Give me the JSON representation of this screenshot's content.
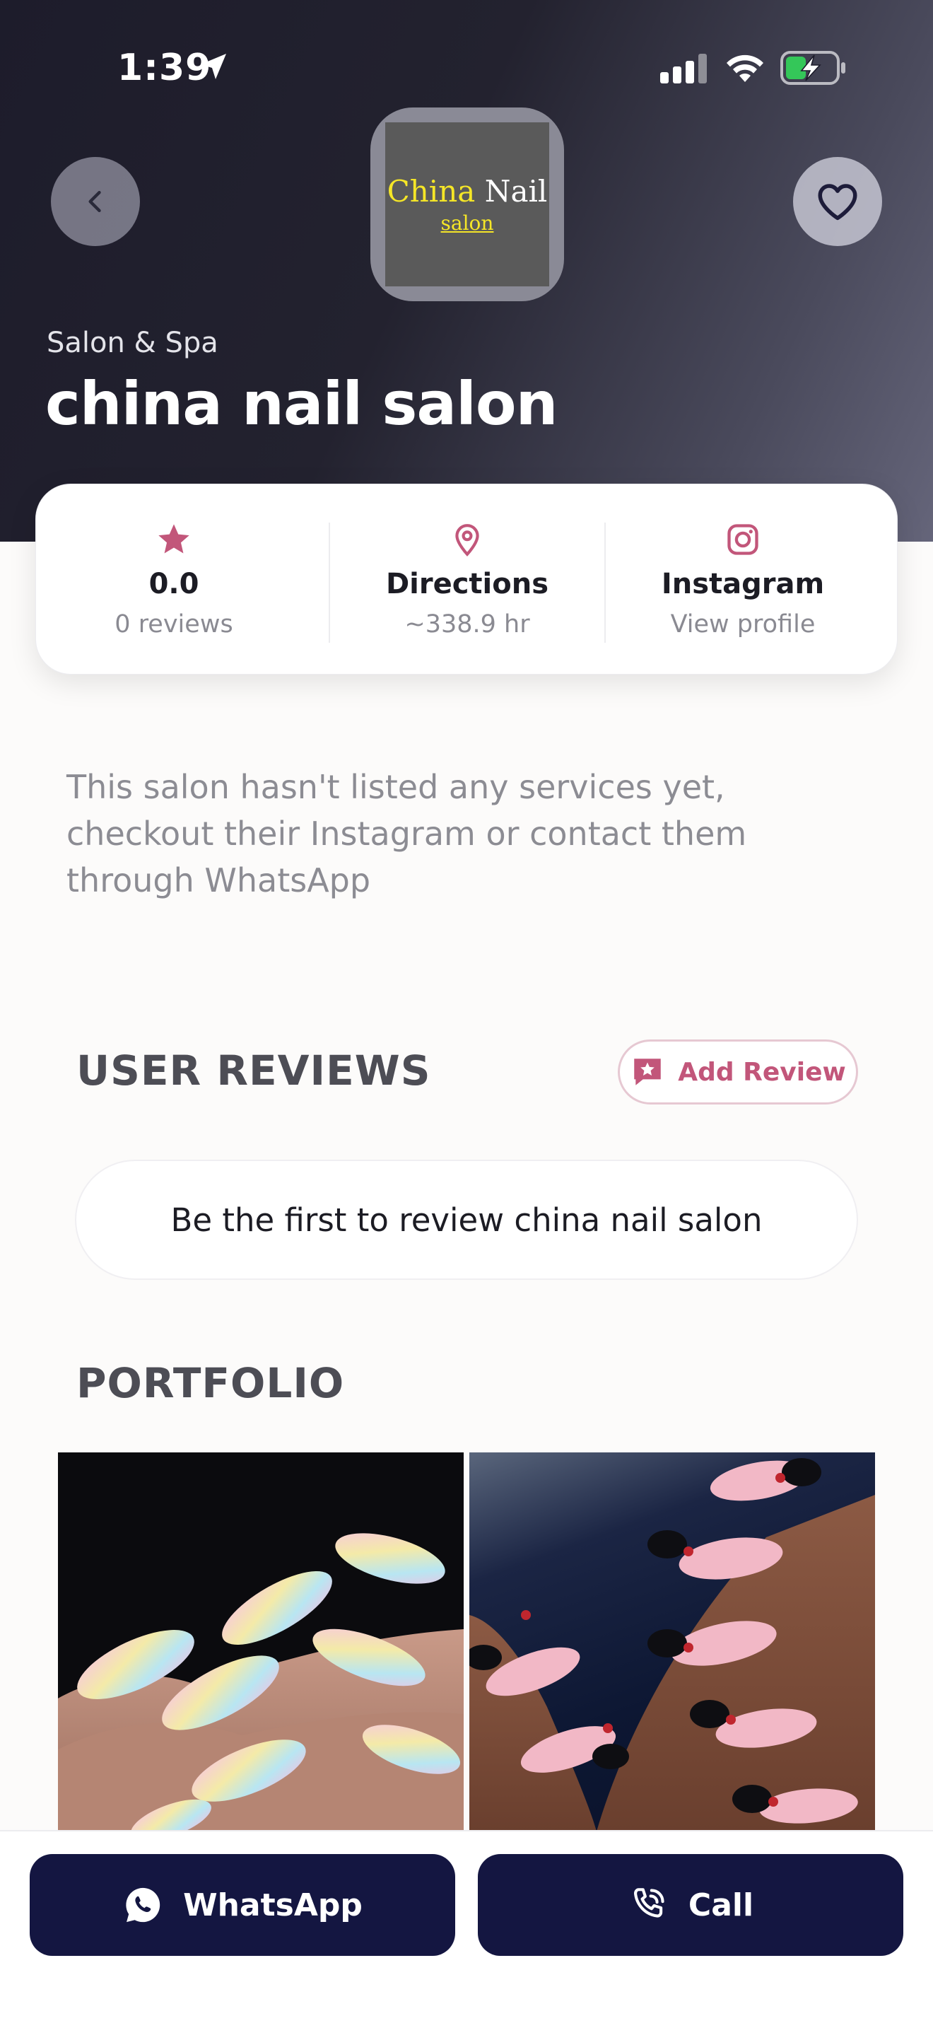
{
  "status_bar": {
    "time": "1:39"
  },
  "header": {
    "logo": {
      "word1": "China",
      "word2": "Nail",
      "sub": "salon"
    },
    "category": "Salon & Spa",
    "title": "china nail salon"
  },
  "info": {
    "rating": {
      "value": "0.0",
      "sub": "0 reviews",
      "icon": "star-icon"
    },
    "directions": {
      "label": "Directions",
      "sub": "~338.9 hr",
      "icon": "location-pin-icon"
    },
    "instagram": {
      "label": "Instagram",
      "sub": "View profile",
      "icon": "instagram-icon"
    }
  },
  "description": "This salon hasn't listed any services yet, checkout their Instagram or contact them through WhatsApp",
  "reviews": {
    "title": "USER REVIEWS",
    "add_label": "Add Review",
    "empty_text": "Be the first to review china nail salon"
  },
  "portfolio": {
    "title": "PORTFOLIO"
  },
  "actions": {
    "whatsapp_label": "WhatsApp",
    "call_label": "Call"
  },
  "colors": {
    "accent": "#c2567a",
    "button": "#141641",
    "header_dark": "#1d1c2b"
  }
}
